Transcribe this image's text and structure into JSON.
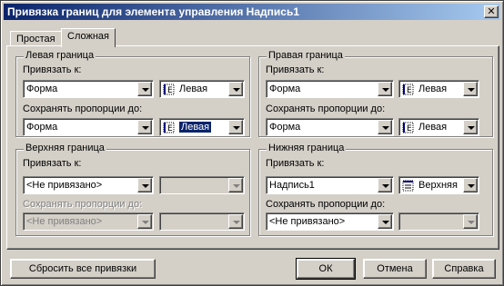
{
  "window": {
    "title": "Привязка границ для элемента управления Надпись1",
    "close_glyph": "✕"
  },
  "tabs": [
    {
      "label": "Простая"
    },
    {
      "label": "Сложная"
    }
  ],
  "groups": {
    "left": {
      "title": "Левая граница",
      "bind_label": "Привязать к:",
      "bind_value": "Форма",
      "bind_side": "Левая",
      "keep_label": "Сохранять пропорции до:",
      "keep_value": "Форма",
      "keep_side": "Левая"
    },
    "right": {
      "title": "Правая граница",
      "bind_label": "Привязать к:",
      "bind_value": "Форма",
      "bind_side": "Левая",
      "keep_label": "Сохранять пропорции до:",
      "keep_value": "Форма",
      "keep_side": "Левая"
    },
    "top": {
      "title": "Верхняя граница",
      "bind_label": "Привязать к:",
      "bind_value": "<Не привязано>",
      "bind_side": "",
      "keep_label": "Сохранять пропорции до:",
      "keep_value": "<Не привязано>",
      "keep_side": ""
    },
    "bottom": {
      "title": "Нижняя граница",
      "bind_label": "Привязать к:",
      "bind_value": "Надпись1",
      "bind_side": "Верхняя",
      "keep_label": "Сохранять пропорции до:",
      "keep_value": "<Не привязано>",
      "keep_side": ""
    }
  },
  "buttons": {
    "reset": "Сбросить все привязки",
    "ok": "ОК",
    "cancel": "Отмена",
    "help": "Справка"
  }
}
